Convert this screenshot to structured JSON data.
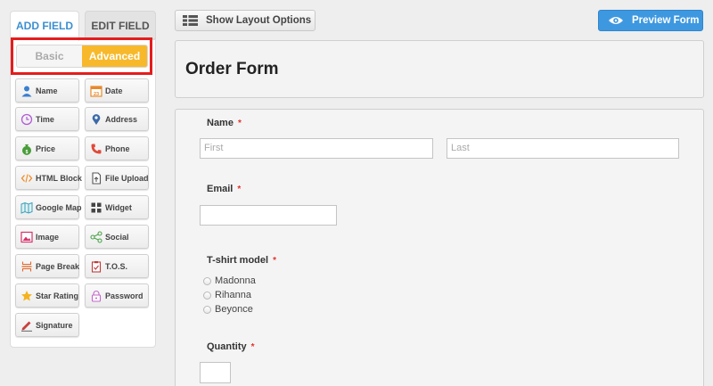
{
  "tabs": {
    "add_field": "ADD FIELD",
    "edit_field": "EDIT FIELD"
  },
  "toggle": {
    "basic": "Basic",
    "advanced": "Advanced",
    "selected": "Advanced"
  },
  "fields": [
    {
      "label": "Name",
      "icon": "user-icon"
    },
    {
      "label": "Date",
      "icon": "calendar-icon"
    },
    {
      "label": "Time",
      "icon": "clock-icon"
    },
    {
      "label": "Address",
      "icon": "map-pin-icon"
    },
    {
      "label": "Price",
      "icon": "money-bag-icon"
    },
    {
      "label": "Phone",
      "icon": "phone-icon"
    },
    {
      "label": "HTML Block",
      "icon": "code-icon"
    },
    {
      "label": "File Upload",
      "icon": "file-upload-icon"
    },
    {
      "label": "Google Map",
      "icon": "map-icon"
    },
    {
      "label": "Widget",
      "icon": "widget-grid-icon"
    },
    {
      "label": "Image",
      "icon": "image-icon"
    },
    {
      "label": "Social",
      "icon": "share-icon"
    },
    {
      "label": "Page Break",
      "icon": "page-break-icon"
    },
    {
      "label": "T.O.S.",
      "icon": "clipboard-icon"
    },
    {
      "label": "Star Rating",
      "icon": "star-icon"
    },
    {
      "label": "Password",
      "icon": "lock-icon"
    },
    {
      "label": "Signature",
      "icon": "pen-icon"
    }
  ],
  "toolbar": {
    "layout_label": "Show Layout Options",
    "preview_label": "Preview Form"
  },
  "form": {
    "title": "Order Form",
    "required_mark": "*",
    "name": {
      "label": "Name",
      "first_placeholder": "First",
      "last_placeholder": "Last"
    },
    "email": {
      "label": "Email",
      "value": ""
    },
    "tshirt": {
      "label": "T-shirt model",
      "options": [
        "Madonna",
        "Rihanna",
        "Beyonce"
      ]
    },
    "quantity": {
      "label": "Quantity",
      "value": ""
    }
  },
  "colors": {
    "accent_blue": "#3e98e0",
    "advanced_yellow": "#f7b92b",
    "highlight_red": "#e41d1d",
    "required_red": "#e0342c"
  }
}
